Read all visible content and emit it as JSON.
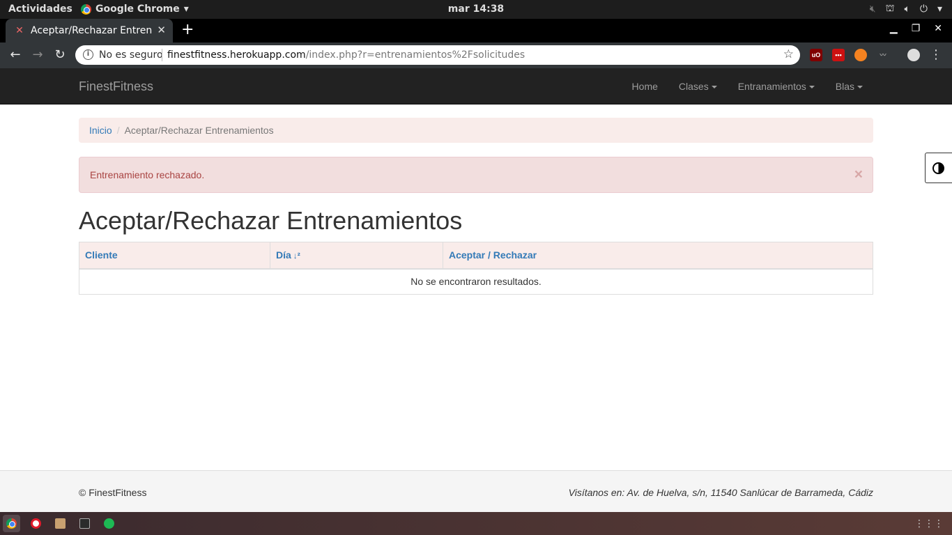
{
  "topbar": {
    "activities": "Actividades",
    "app_name": "Google Chrome",
    "clock": "mar 14:38"
  },
  "browser": {
    "tab_title": "Aceptar/Rechazar Entren",
    "security_label": "No es seguro",
    "url_host": "finestfitness.herokuapp.com",
    "url_path": "/index.php?r=entrenamientos%2Fsolicitudes"
  },
  "navbar": {
    "brand": "FinestFitness",
    "items": [
      {
        "label": "Home",
        "dropdown": false
      },
      {
        "label": "Clases",
        "dropdown": true
      },
      {
        "label": "Entranamientos",
        "dropdown": true
      },
      {
        "label": "Blas",
        "dropdown": true
      }
    ]
  },
  "breadcrumb": {
    "home": "Inicio",
    "current": "Aceptar/Rechazar Entrenamientos"
  },
  "alert": {
    "message": "Entrenamiento rechazado.",
    "close": "×"
  },
  "page": {
    "title": "Aceptar/Rechazar Entrenamientos"
  },
  "table": {
    "columns": [
      "Cliente",
      "Día",
      "Aceptar / Rechazar"
    ],
    "empty_message": "No se encontraron resultados."
  },
  "footer": {
    "copyright": "© FinestFitness",
    "address": "Visítanos en: Av. de Huelva, s/n, 11540 Sanlúcar de Barrameda, Cádiz"
  },
  "colors": {
    "navbar_bg": "#222222",
    "link": "#337ab7",
    "alert_bg": "#f2dede",
    "alert_text": "#a94442",
    "breadcrumb_bg": "#f9ecea"
  }
}
